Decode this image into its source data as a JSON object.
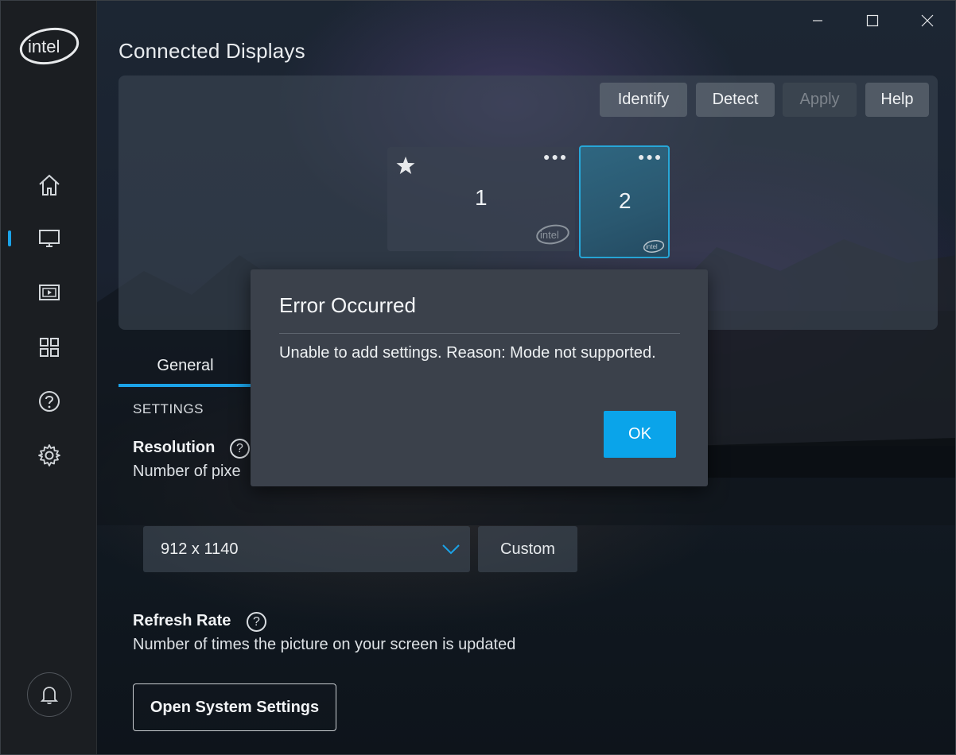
{
  "app": {
    "logo_text": "intel",
    "page_title": "Connected Displays"
  },
  "sidebar": {
    "items": [
      {
        "name": "home",
        "icon": "home-icon",
        "active": false
      },
      {
        "name": "display",
        "icon": "monitor-icon",
        "active": true
      },
      {
        "name": "video",
        "icon": "video-icon",
        "active": false
      },
      {
        "name": "apps",
        "icon": "grid-icon",
        "active": false
      },
      {
        "name": "support",
        "icon": "question-icon",
        "active": false
      },
      {
        "name": "settings",
        "icon": "gear-icon",
        "active": false
      }
    ],
    "notifications_icon": "bell-icon"
  },
  "window_controls": {
    "minimize_icon": "minimize-icon",
    "maximize_icon": "maximize-icon",
    "close_icon": "close-icon"
  },
  "display_toolbar": {
    "identify": "Identify",
    "detect": "Detect",
    "apply": "Apply",
    "help": "Help"
  },
  "displays": [
    {
      "number": "1",
      "primary": true,
      "selected": false
    },
    {
      "number": "2",
      "primary": false,
      "selected": true
    }
  ],
  "tabs": {
    "general": "General"
  },
  "settings": {
    "section_label": "SETTINGS",
    "resolution": {
      "title": "Resolution",
      "description": "Number of pixe",
      "selected_value": "912 x 1140",
      "custom_label": "Custom"
    },
    "refresh_rate": {
      "title": "Refresh Rate",
      "description": "Number of times the picture on your screen is updated"
    },
    "open_system_settings": "Open System Settings",
    "help_glyph": "?"
  },
  "dialog": {
    "title": "Error Occurred",
    "message": "Unable to add settings. Reason: Mode not supported.",
    "ok_label": "OK"
  },
  "colors": {
    "accent": "#1ba3e8",
    "dialog_bg": "#3b414b",
    "sidebar_bg": "#1b1e22"
  }
}
